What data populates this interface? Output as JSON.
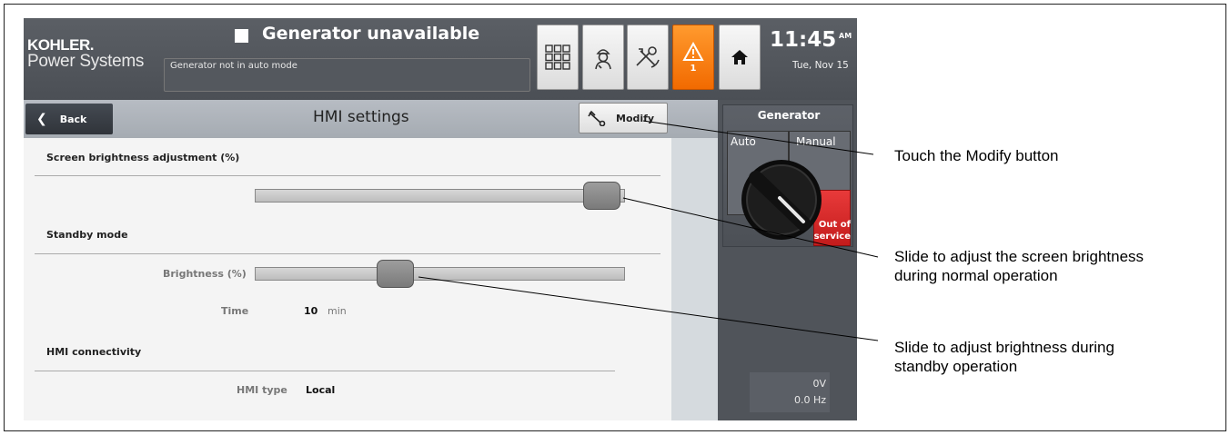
{
  "topbar": {
    "logo_brand": "KOHLER.",
    "logo_sub": "Power Systems",
    "status_title": "Generator unavailable",
    "status_message": "Generator not in auto mode",
    "alarm_count": "1",
    "time": "11:45",
    "ampm": "AM",
    "date": "Tue, Nov 15",
    "colors": {
      "alarm": "#f26a00",
      "bar": "#4b4f55"
    }
  },
  "panel": {
    "back_label": "Back",
    "title": "HMI settings",
    "modify_label": "Modify",
    "screen_brightness": {
      "heading": "Screen brightness adjustment (%)",
      "level_fraction": 0.94
    },
    "standby": {
      "heading": "Standby mode",
      "brightness_label": "Brightness (%)",
      "brightness_fraction": 0.38,
      "time_label": "Time",
      "time_value": "10",
      "time_unit": "min"
    },
    "connectivity": {
      "heading": "HMI connectivity",
      "type_label": "HMI type",
      "type_value": "Local"
    }
  },
  "generator": {
    "title": "Generator",
    "auto_label": "Auto",
    "manual_label": "Manual",
    "oos_label_1": "Out of",
    "oos_label_2": "service",
    "voltage": "0V",
    "frequency": "0.0 Hz",
    "colors": {
      "out_of_service": "#d42a2a"
    }
  },
  "callouts": {
    "modify": "Touch the Modify button",
    "brightness_1": "Slide to adjust the screen brightness",
    "brightness_2": "during normal operation",
    "standby_1": "Slide to adjust brightness during",
    "standby_2": "standby operation"
  }
}
